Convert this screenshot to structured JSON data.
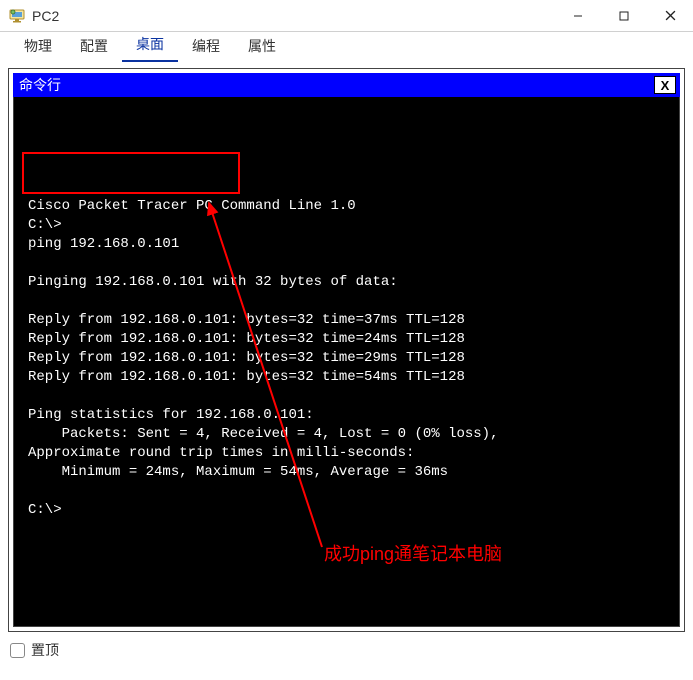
{
  "window": {
    "title": "PC2",
    "app_icon_name": "pc-icon"
  },
  "tabs": {
    "items": [
      {
        "label": "物理"
      },
      {
        "label": "配置"
      },
      {
        "label": "桌面"
      },
      {
        "label": "编程"
      },
      {
        "label": "属性"
      }
    ],
    "active_index": 2
  },
  "cmd_panel": {
    "title": "命令行",
    "close_label": "X"
  },
  "terminal": {
    "lines": [
      "Cisco Packet Tracer PC Command Line 1.0",
      "C:\\>",
      "ping 192.168.0.101",
      "",
      "Pinging 192.168.0.101 with 32 bytes of data:",
      "",
      "Reply from 192.168.0.101: bytes=32 time=37ms TTL=128",
      "Reply from 192.168.0.101: bytes=32 time=24ms TTL=128",
      "Reply from 192.168.0.101: bytes=32 time=29ms TTL=128",
      "Reply from 192.168.0.101: bytes=32 time=54ms TTL=128",
      "",
      "Ping statistics for 192.168.0.101:",
      "    Packets: Sent = 4, Received = 4, Lost = 0 (0% loss),",
      "Approximate round trip times in milli-seconds:",
      "    Minimum = 24ms, Maximum = 54ms, Average = 36ms",
      "",
      "C:\\>"
    ],
    "highlighted_command_index": 2
  },
  "annotation": {
    "text": "成功ping通笔记本电脑"
  },
  "footer": {
    "always_on_top_label": "置顶",
    "checked": false
  }
}
